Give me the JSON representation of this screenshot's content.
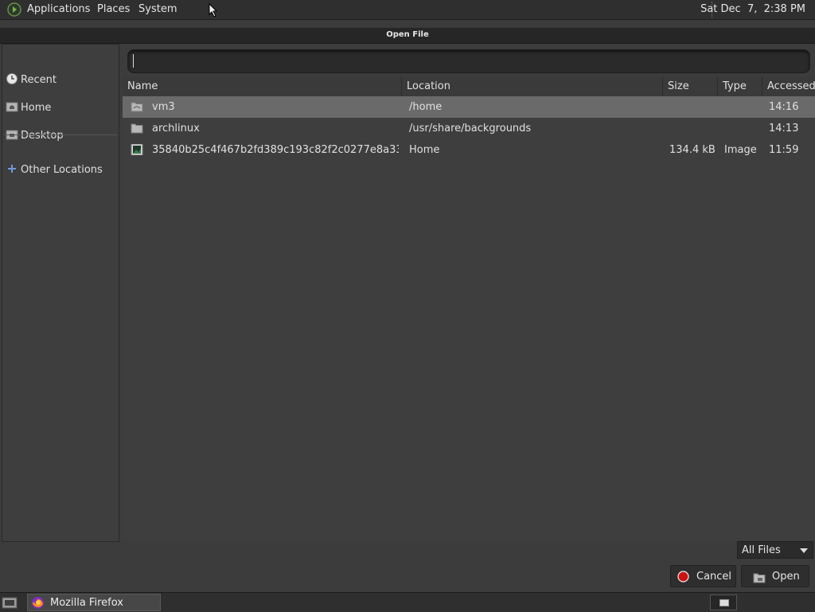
{
  "top_panel": {
    "menus": [
      "Applications",
      "Places",
      "System"
    ],
    "clock": "Sat Dec  7,  2:38 PM"
  },
  "dialog": {
    "title": "Open File",
    "location_value": "",
    "places": [
      {
        "label": "Recent",
        "icon": "clock-icon"
      },
      {
        "label": "Home",
        "icon": "home-folder-icon"
      },
      {
        "label": "Desktop",
        "icon": "desktop-folder-icon"
      },
      {
        "label": "Other Locations",
        "icon": "plus-icon"
      }
    ],
    "columns": {
      "name": "Name",
      "location": "Location",
      "size": "Size",
      "type": "Type",
      "accessed": "Accessed"
    },
    "files": [
      {
        "name": "vm3",
        "location": "/home",
        "size": "",
        "type": "",
        "accessed": "14:16",
        "icon": "folder-icon",
        "selected": true
      },
      {
        "name": "archlinux",
        "location": "/usr/share/backgrounds",
        "size": "",
        "type": "",
        "accessed": "14:13",
        "icon": "folder-icon",
        "selected": false
      },
      {
        "name": "35840b25c4f467b2fd389c193c82f2c0277e8a33...",
        "location": "Home",
        "size": "134.4 kB",
        "type": "Image",
        "accessed": "11:59",
        "icon": "image-file-icon",
        "selected": false
      }
    ],
    "filter": "All Files",
    "cancel_label": "Cancel",
    "open_label": "Open"
  },
  "taskbar": {
    "window_label": "Mozilla Firefox"
  },
  "colors": {
    "cancel_icon": "#cc1111",
    "selected_row": "#6a6a6a"
  }
}
